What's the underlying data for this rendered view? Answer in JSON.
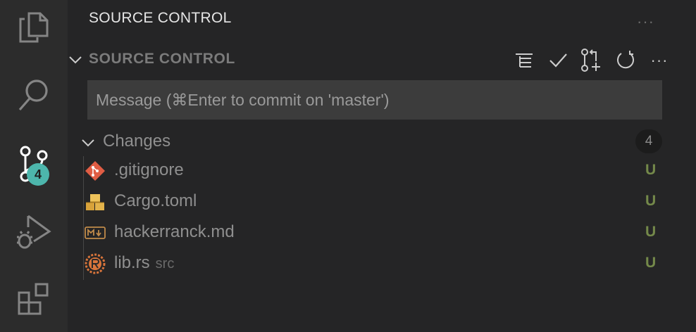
{
  "activity_bar": {
    "scm_badge": "4"
  },
  "sidebar": {
    "view_title": "SOURCE CONTROL",
    "more": "···",
    "section_title": "SOURCE CONTROL",
    "toolbar_more": "···"
  },
  "commit": {
    "placeholder": "Message (⌘Enter to commit on 'master')"
  },
  "changes": {
    "label": "Changes",
    "count": "4",
    "files": [
      {
        "name": ".gitignore",
        "dir": "",
        "status": "U"
      },
      {
        "name": "Cargo.toml",
        "dir": "",
        "status": "U"
      },
      {
        "name": "hackerranck.md",
        "dir": "",
        "status": "U"
      },
      {
        "name": "lib.rs",
        "dir": "src",
        "status": "U"
      }
    ]
  },
  "colors": {
    "accent_badge": "#4db6ac",
    "untracked": "#74894a"
  }
}
